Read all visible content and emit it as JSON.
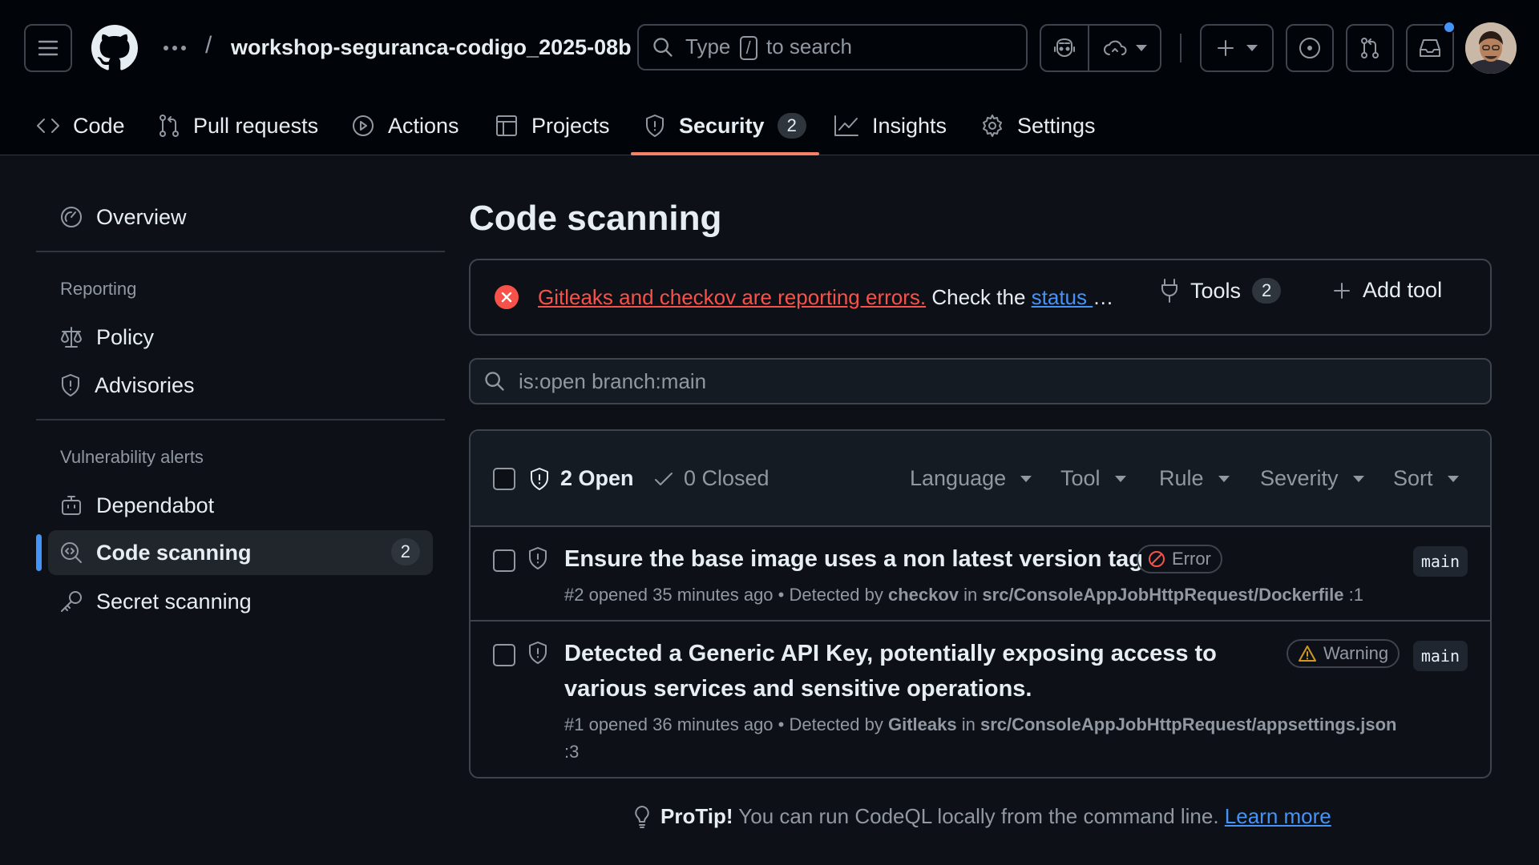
{
  "header": {
    "repo_name": "workshop-seguranca-codigo_2025-08b",
    "breadcrumb_sep": "/",
    "search_prefix": "Type",
    "search_key": "/",
    "search_suffix": "to search"
  },
  "nav": {
    "tabs": [
      {
        "label": "Code"
      },
      {
        "label": "Pull requests"
      },
      {
        "label": "Actions"
      },
      {
        "label": "Projects"
      },
      {
        "label": "Security",
        "count": "2"
      },
      {
        "label": "Insights"
      },
      {
        "label": "Settings"
      }
    ],
    "active": "Security"
  },
  "sidebar": {
    "overview": "Overview",
    "reporting_heading": "Reporting",
    "policy": "Policy",
    "advisories": "Advisories",
    "vuln_heading": "Vulnerability alerts",
    "dependabot": "Dependabot",
    "code_scanning": "Code scanning",
    "code_scanning_count": "2",
    "secret_scanning": "Secret scanning"
  },
  "main": {
    "title": "Code scanning",
    "banner": {
      "error_link": "Gitleaks and checkov are reporting errors.",
      "check_text": " Check the ",
      "status_link": "status page for help."
    },
    "tools_label": "Tools",
    "tools_count": "2",
    "add_tool_label": "Add tool",
    "filter_value": "is:open branch:main"
  },
  "alerts_header": {
    "open_label": "2 Open",
    "closed_label": "0 Closed",
    "filters": [
      "Language",
      "Tool",
      "Rule",
      "Severity",
      "Sort"
    ]
  },
  "alerts": [
    {
      "title": "Ensure the base image uses a non latest version tag",
      "severity": "Error",
      "branch": "main",
      "meta_prefix": "#2 opened 35 minutes ago • Detected by ",
      "tool": "checkov",
      "meta_in": " in ",
      "path": "src/ConsoleAppJobHttpRequest/Dockerfile",
      "line": " :1"
    },
    {
      "title": "Detected a Generic API Key, potentially exposing access to various services and sensitive operations.",
      "severity": "Warning",
      "branch": "main",
      "meta_prefix": "#1 opened 36 minutes ago • Detected by ",
      "tool": "Gitleaks",
      "meta_in": " in ",
      "path": "src/ConsoleAppJobHttpRequest/appsettings.json",
      "line": ":3"
    }
  ],
  "protip": {
    "label": "ProTip!",
    "text": " You can run CodeQL locally from the command line. ",
    "link": "Learn more"
  },
  "colors": {
    "background": "#0d1117",
    "accent_tab": "#f78166",
    "link": "#4493f8",
    "error": "#f85149",
    "warning": "#d29922"
  }
}
